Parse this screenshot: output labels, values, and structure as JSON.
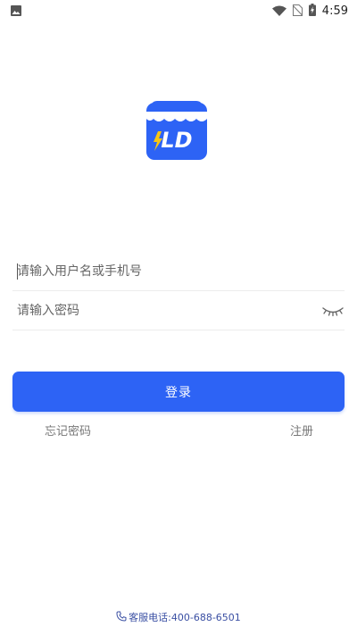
{
  "status_bar": {
    "time": "4:59",
    "icons": [
      "image-icon",
      "wifi-icon",
      "no-sim-icon",
      "battery-charging-icon"
    ]
  },
  "logo": {
    "text": "LD",
    "color": "#2d63f5"
  },
  "login_form": {
    "username_placeholder": "请输入用户名或手机号",
    "password_placeholder": "请输入密码",
    "submit_label": "登录",
    "forgot_password": "忘记密码",
    "register": "注册"
  },
  "footer": {
    "service_hotline": "客服电话:400-688-6501",
    "icon": "phone-icon"
  },
  "colors": {
    "primary": "#2d63f5",
    "link_gray": "#777777",
    "footer_text": "#3a4fa3"
  }
}
